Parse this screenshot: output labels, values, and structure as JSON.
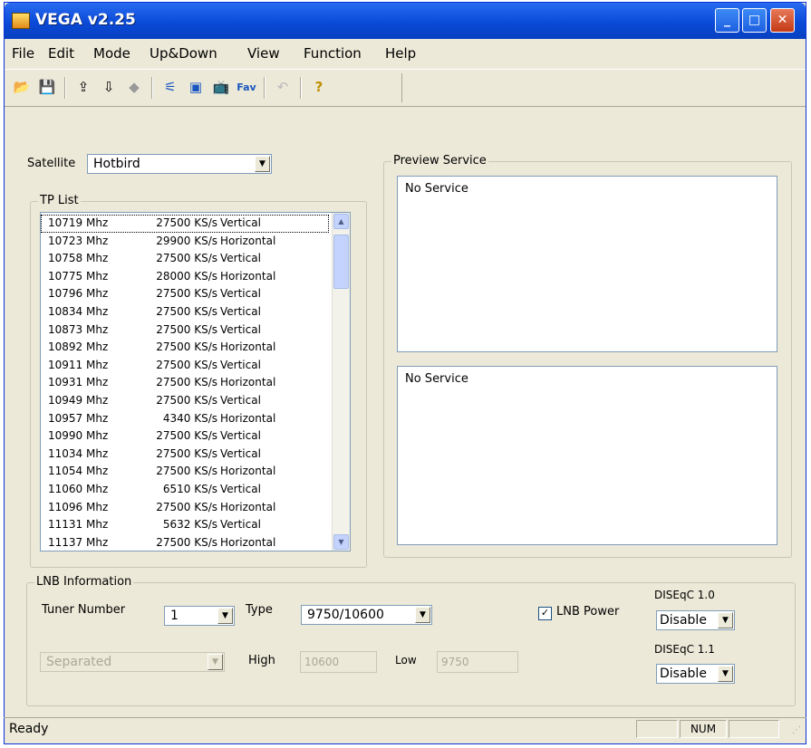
{
  "window": {
    "title": "VEGA v2.25",
    "min": "_",
    "max": "□",
    "close": "✕"
  },
  "menu": [
    "File",
    "Edit",
    "Mode",
    "Up&Down",
    "View",
    "Function",
    "Help"
  ],
  "toolbar_icons": [
    "open-icon",
    "save-icon",
    "export-icon",
    "import-icon",
    "signal-icon",
    "antenna-icon",
    "monitor-icon",
    "tv-icon",
    "fav-icon",
    "undo-icon",
    "help-icon"
  ],
  "satellite": {
    "label": "Satellite",
    "value": "Hotbird"
  },
  "tp_list": {
    "title": "TP List",
    "rows": [
      {
        "freq": "10719 Mhz",
        "sym": "27500 KS/s",
        "pol": "Vertical"
      },
      {
        "freq": "10723 Mhz",
        "sym": "29900 KS/s",
        "pol": "Horizontal"
      },
      {
        "freq": "10758 Mhz",
        "sym": "27500 KS/s",
        "pol": "Vertical"
      },
      {
        "freq": "10775 Mhz",
        "sym": "28000 KS/s",
        "pol": "Horizontal"
      },
      {
        "freq": "10796 Mhz",
        "sym": "27500 KS/s",
        "pol": "Vertical"
      },
      {
        "freq": "10834 Mhz",
        "sym": "27500 KS/s",
        "pol": "Vertical"
      },
      {
        "freq": "10873 Mhz",
        "sym": "27500 KS/s",
        "pol": "Vertical"
      },
      {
        "freq": "10892 Mhz",
        "sym": "27500 KS/s",
        "pol": "Horizontal"
      },
      {
        "freq": "10911 Mhz",
        "sym": "27500 KS/s",
        "pol": "Vertical"
      },
      {
        "freq": "10931 Mhz",
        "sym": "27500 KS/s",
        "pol": "Horizontal"
      },
      {
        "freq": "10949 Mhz",
        "sym": "27500 KS/s",
        "pol": "Vertical"
      },
      {
        "freq": "10957 Mhz",
        "sym": "4340 KS/s",
        "pol": "Horizontal"
      },
      {
        "freq": "10990 Mhz",
        "sym": "27500 KS/s",
        "pol": "Vertical"
      },
      {
        "freq": "11034 Mhz",
        "sym": "27500 KS/s",
        "pol": "Vertical"
      },
      {
        "freq": "11054 Mhz",
        "sym": "27500 KS/s",
        "pol": "Horizontal"
      },
      {
        "freq": "11060 Mhz",
        "sym": "6510 KS/s",
        "pol": "Vertical"
      },
      {
        "freq": "11096 Mhz",
        "sym": "27500 KS/s",
        "pol": "Horizontal"
      },
      {
        "freq": "11131 Mhz",
        "sym": "5632 KS/s",
        "pol": "Vertical"
      },
      {
        "freq": "11137 Mhz",
        "sym": "27500 KS/s",
        "pol": "Horizontal"
      }
    ]
  },
  "preview": {
    "title": "Preview Service",
    "top_text": "No Service",
    "bottom_text": "No Service"
  },
  "lnb": {
    "title": "LNB Information",
    "tuner_label": "Tuner Number",
    "tuner_value": "1",
    "type_label": "Type",
    "type_value": "9750/10600",
    "separated_value": "Separated",
    "high_label": "High",
    "high_value": "10600",
    "low_label": "Low",
    "low_value": "9750",
    "power_label": "LNB Power",
    "power_checked": "✓",
    "diseqc10_label": "DISEqC 1.0",
    "diseqc10_value": "Disable",
    "diseqc11_label": "DISEqC 1.1",
    "diseqc11_value": "Disable"
  },
  "status": {
    "text": "Ready",
    "num": "NUM"
  }
}
